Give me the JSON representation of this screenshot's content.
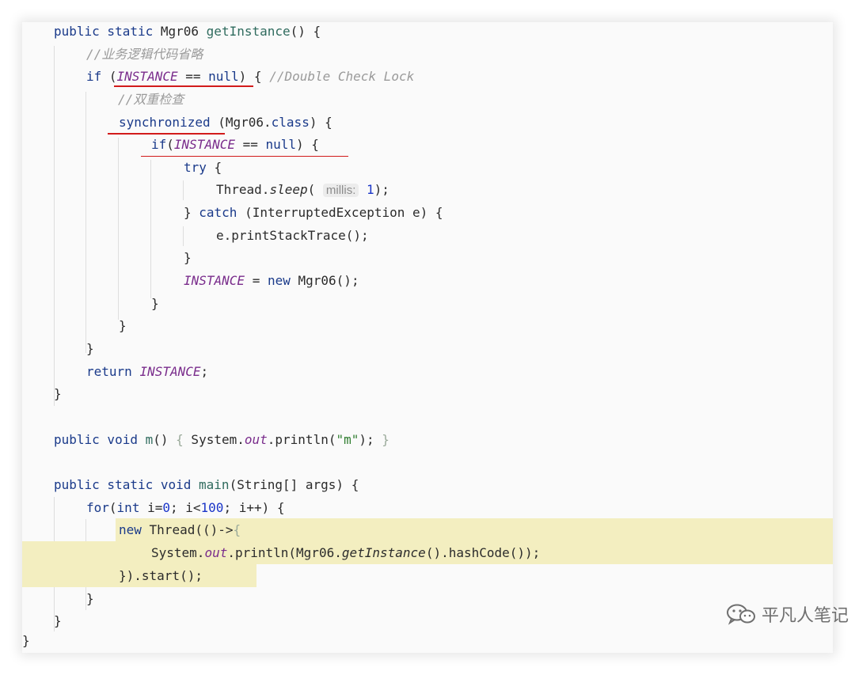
{
  "code": {
    "l01": {
      "kw": "public static",
      "type": " Mgr06 ",
      "mth": "getInstance",
      "rest": "() {"
    },
    "l02": {
      "comment": "//业务逻辑代码省略"
    },
    "l03": {
      "kw": "if",
      "open": " (",
      "field": "INSTANCE",
      "op": " == ",
      "nul": "null",
      "close": ") { ",
      "comment": "//Double Check Lock"
    },
    "l04": {
      "comment": "//双重检查"
    },
    "l05": {
      "kw": "synchronized",
      "rest": " (Mgr06.",
      "cls": "class",
      "close": ") {"
    },
    "l06": {
      "kw": "if",
      "open": "(",
      "field": "INSTANCE",
      "op": " == ",
      "nul": "null",
      "close": ") {"
    },
    "l07": {
      "kw": "try",
      "rest": " {"
    },
    "l08": {
      "pre": "Thread.",
      "mth": "sleep",
      "open": "( ",
      "hint": "millis:",
      "num": " 1",
      "close": ");"
    },
    "l09": {
      "pre": "} ",
      "kw": "catch",
      "rest": " (InterruptedException e) {"
    },
    "l10": {
      "text": "e.printStackTrace();"
    },
    "l11": {
      "text": "}"
    },
    "l12": {
      "field": "INSTANCE",
      "op": " = ",
      "kw": "new",
      "rest": " Mgr06();"
    },
    "l13": {
      "text": "}"
    },
    "l14": {
      "text": "}"
    },
    "l15": {
      "text": "}"
    },
    "l16": {
      "kw": "return",
      "sp": " ",
      "field": "INSTANCE",
      "semi": ";"
    },
    "l17": {
      "text": "}"
    },
    "l19": {
      "kw": "public void",
      "sp": " ",
      "mth": "m",
      "p": "() ",
      "fold1": "{",
      "sys": " System.",
      "out": "out",
      "call": ".println(",
      "str": "\"m\"",
      "end": "); ",
      "fold2": "}"
    },
    "l21": {
      "kw": "public static void",
      "sp": " ",
      "mth": "main",
      "rest": "(String[] args) {"
    },
    "l22": {
      "kw": "for",
      "open": "(",
      "kw2": "int",
      "a": " i=",
      "n0": "0",
      "b": "; i<",
      "n100": "100",
      "c": "; i++) {"
    },
    "l23": {
      "kw": "new",
      "rest": " Thread(()->",
      "fold": "{"
    },
    "l24": {
      "sys": "System.",
      "out": "out",
      "a": ".println(Mgr06.",
      "mth": "getInstance",
      "b": "().hashCode());"
    },
    "l25": {
      "text": "}).start();"
    },
    "l26": {
      "text": "}"
    },
    "l27": {
      "text": "}"
    },
    "l28": {
      "text": "}"
    }
  },
  "watermark": {
    "text": "平凡人笔记",
    "icon": "wechat-icon"
  },
  "colors": {
    "keyword": "#1a3a8a",
    "field": "#7a2d8c",
    "comment": "#9a9a9a",
    "highlight": "#f3eec0",
    "underline": "#d21b1b"
  }
}
